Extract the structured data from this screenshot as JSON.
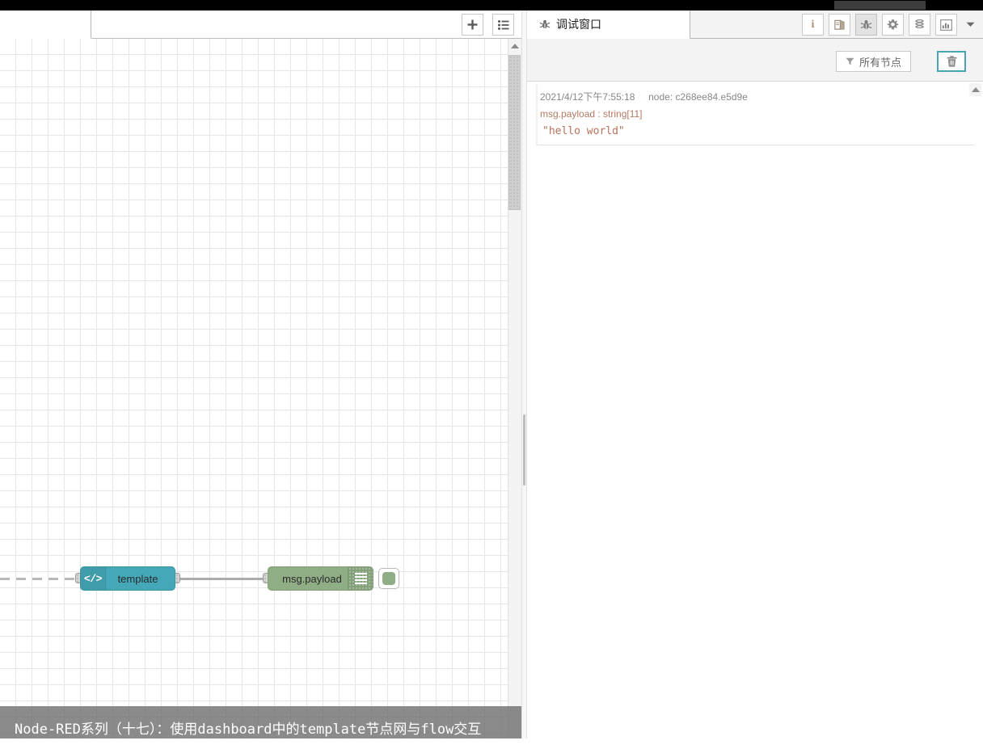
{
  "window": {
    "top_strip": "",
    "top_strip_bar": ""
  },
  "workspace": {
    "tab_label": "",
    "add_tab_icon": "plus-icon",
    "list_tabs_icon": "list-icon"
  },
  "flow": {
    "nodes": [
      {
        "id": "template",
        "label": "template",
        "icon": "</>",
        "icon_name": "code-icon",
        "color": "#44a8b8",
        "type": "template"
      },
      {
        "id": "debug",
        "label": "msg.payload",
        "icon_name": "debug-lines-icon",
        "color": "#8fae86",
        "type": "debug",
        "status_button": "debug-toggle-button"
      }
    ],
    "wire_color": "#acacac"
  },
  "caption": {
    "text": "Node-RED系列（十七）：使用dashboard中的template节点网与flow交互"
  },
  "sidebar": {
    "active_tab": {
      "label": "调试窗口",
      "icon_name": "bug-icon"
    },
    "tab_icons": [
      {
        "name": "info-icon",
        "glyph": "i",
        "active": false
      },
      {
        "name": "help-book-icon",
        "glyph": "",
        "active": false
      },
      {
        "name": "bug-icon",
        "glyph": "",
        "active": true
      },
      {
        "name": "gear-icon",
        "glyph": "",
        "active": false
      },
      {
        "name": "context-stack-icon",
        "glyph": "",
        "active": false
      },
      {
        "name": "dashboard-chart-icon",
        "glyph": "",
        "active": false
      }
    ],
    "caret_icon": "chevron-down-icon",
    "toolbar": {
      "filter_label": "所有节点",
      "filter_icon": "filter-icon",
      "clear_icon": "trash-icon",
      "clear_focus_color": "#4ba4b5"
    },
    "messages": [
      {
        "timestamp": "2021/4/12下午7:55:18",
        "node": "node: c268ee84.e5d9e",
        "property": "msg.payload : string[11]",
        "value": "\"hello world\""
      }
    ]
  }
}
